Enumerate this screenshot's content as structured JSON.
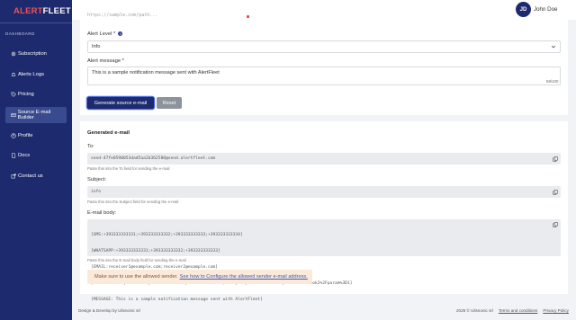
{
  "brand": {
    "name_part1": "ALERT",
    "name_part2": "FLEET"
  },
  "user": {
    "initials": "JD",
    "name": "John Doe"
  },
  "faded_url_fragment": "https://sample.com/path...",
  "sidebar": {
    "section_label": "DASHBOARD",
    "items": [
      {
        "label": "Subscription",
        "icon": "gear-icon"
      },
      {
        "label": "Alerts Logs",
        "icon": "bell-icon"
      },
      {
        "label": "Pricing",
        "icon": "tag-icon"
      },
      {
        "label": "Source E-mail Builder",
        "icon": "envelope-icon",
        "active": true
      },
      {
        "label": "Profile",
        "icon": "user-icon"
      },
      {
        "label": "Docs",
        "icon": "doc-icon"
      },
      {
        "label": "Contact us",
        "icon": "external-link-icon"
      }
    ]
  },
  "form": {
    "alert_level_label": "Alert Level *",
    "alert_level_value": "Info",
    "alert_message_label": "Alert message *",
    "alert_message_value": "This is a sample notification message sent with AlertFleet",
    "char_counter": "58/100",
    "generate_button": "Generate source e-mail",
    "reset_button": "Reset"
  },
  "generated": {
    "title": "Generated e-mail",
    "to_label": "To:",
    "to_value": "send-47fe0590053dad5aa2b362580@send.alertfleet.com",
    "to_hint": "Paste this into the To field for sending the e-mail",
    "subject_label": "Subject:",
    "subject_value": "info",
    "subject_hint": "Paste this into the Subject field for sending the e-mail",
    "body_label": "E-mail body:",
    "body_lines": [
      "[SMS:+393333333331;+393333333332;+393333333333;+393333333334]",
      "[WHATSAPP:+393333333331;+393333333332;+393333333333]",
      "[EMAIL:receiver1@example.com;receiver2@example.com]",
      "[WEBHOOK:POST|GET%7Chttps%3A%2F%2Fexample.com%2Fhook1;POST|https%3A%2F%2Fexample.com%2Fhook2%2Fparam%3D1]",
      "[MESSAGE: This is a sample notification message sent with AlertFleet]"
    ],
    "body_hint": "Paste this into the E-mail body field for sending the e-mail"
  },
  "alert_note": {
    "text": "Make sure to use the allowed sender.",
    "link": "See how to Configure the allowed sender e-mail address."
  },
  "footer": {
    "left": "Design & Develop by Ulisnonic srl",
    "copyright": "2025 © Ulisnonic srl",
    "terms": "Terms and conditions",
    "privacy": "Privacy Policy"
  },
  "colors": {
    "sidebar": "#1e2a6e",
    "accent": "#e9525a",
    "primary_button": "#1e2a6e",
    "reset_button": "#8d939b",
    "alert_bg": "#fbead9"
  }
}
